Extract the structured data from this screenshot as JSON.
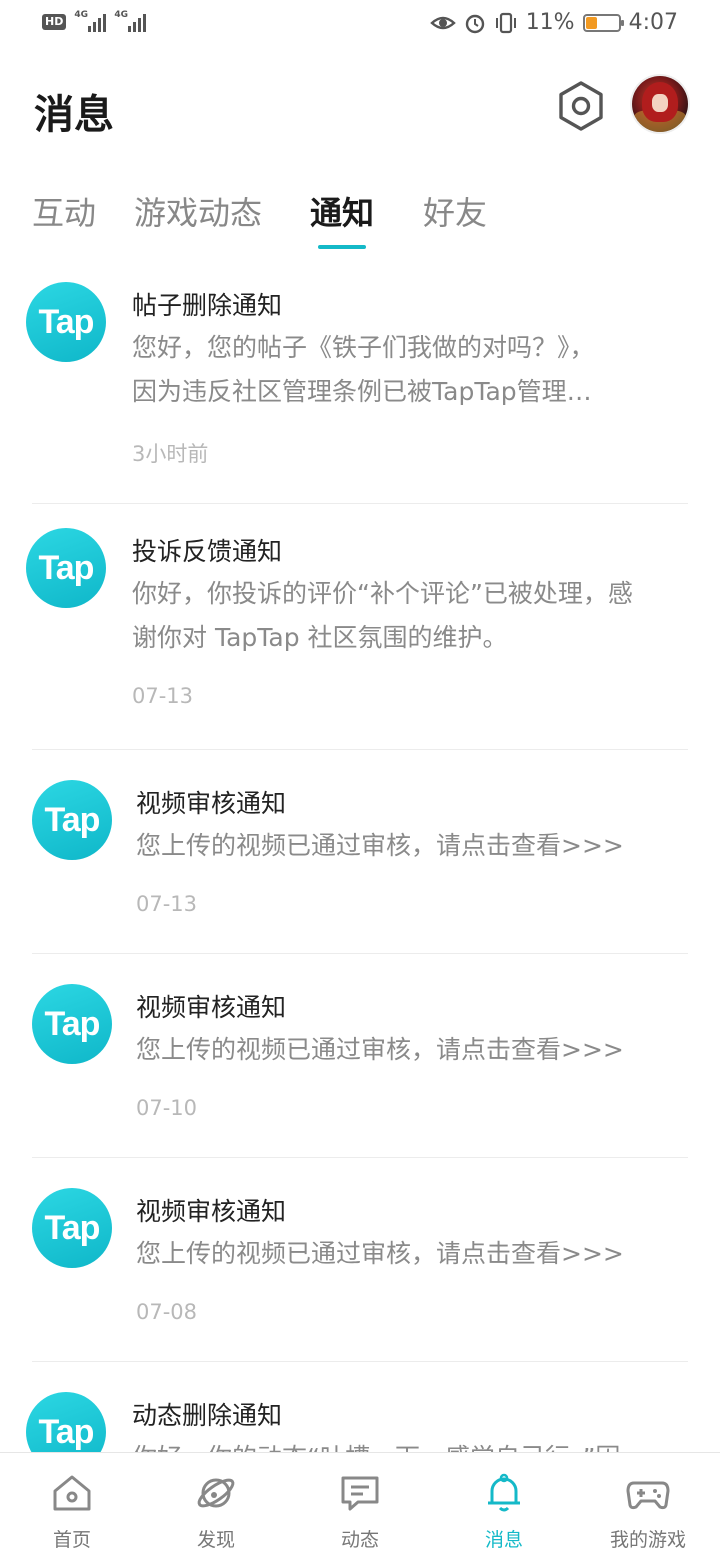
{
  "status_bar": {
    "hd": "HD",
    "net1": "4G",
    "net2": "4G",
    "battery_pct": "11%",
    "battery_level": 0.11,
    "time": "4:07",
    "battery_color": "#f29a22"
  },
  "header": {
    "title": "消息",
    "settings_icon": "hexagon-settings-icon",
    "avatar_icon": "user-avatar"
  },
  "tabs": [
    {
      "label": "互动",
      "active": false
    },
    {
      "label": "游戏动态",
      "active": false
    },
    {
      "label": "通知",
      "active": true
    },
    {
      "label": "好友",
      "active": false
    }
  ],
  "accent_color": "#14b9c8",
  "notifications": [
    {
      "logo": "Tap",
      "title": "帖子删除通知",
      "body1": "您好，您的帖子《铁子们我做的对吗？》，",
      "body2": "因为违反社区管理条例已被TapTap管理…",
      "time": "3小时前"
    },
    {
      "logo": "Tap",
      "title": "投诉反馈通知",
      "body1": "你好，你投诉的评价“补个评论”已被处理，感",
      "body2": "谢你对 TapTap 社区氛围的维护。",
      "time": "07-13"
    },
    {
      "logo": "Tap",
      "title": "视频审核通知",
      "body1": "您上传的视频已通过审核，请点击查看>>>",
      "time": "07-13"
    },
    {
      "logo": "Tap",
      "title": "视频审核通知",
      "body1": "您上传的视频已通过审核，请点击查看>>>",
      "time": "07-10"
    },
    {
      "logo": "Tap",
      "title": "视频审核通知",
      "body1": "您上传的视频已通过审核，请点击查看>>>",
      "time": "07-08"
    },
    {
      "logo": "Tap",
      "title": "动态删除通知",
      "body1": "你好，你的动态“吐槽一下，感觉自己行。”因"
    }
  ],
  "bottom_nav": [
    {
      "label": "首页",
      "icon": "home-icon"
    },
    {
      "label": "发现",
      "icon": "planet-icon"
    },
    {
      "label": "动态",
      "icon": "chat-bubble-icon"
    },
    {
      "label": "消息",
      "icon": "bell-icon",
      "active": true
    },
    {
      "label": "我的游戏",
      "icon": "gamepad-icon"
    }
  ]
}
